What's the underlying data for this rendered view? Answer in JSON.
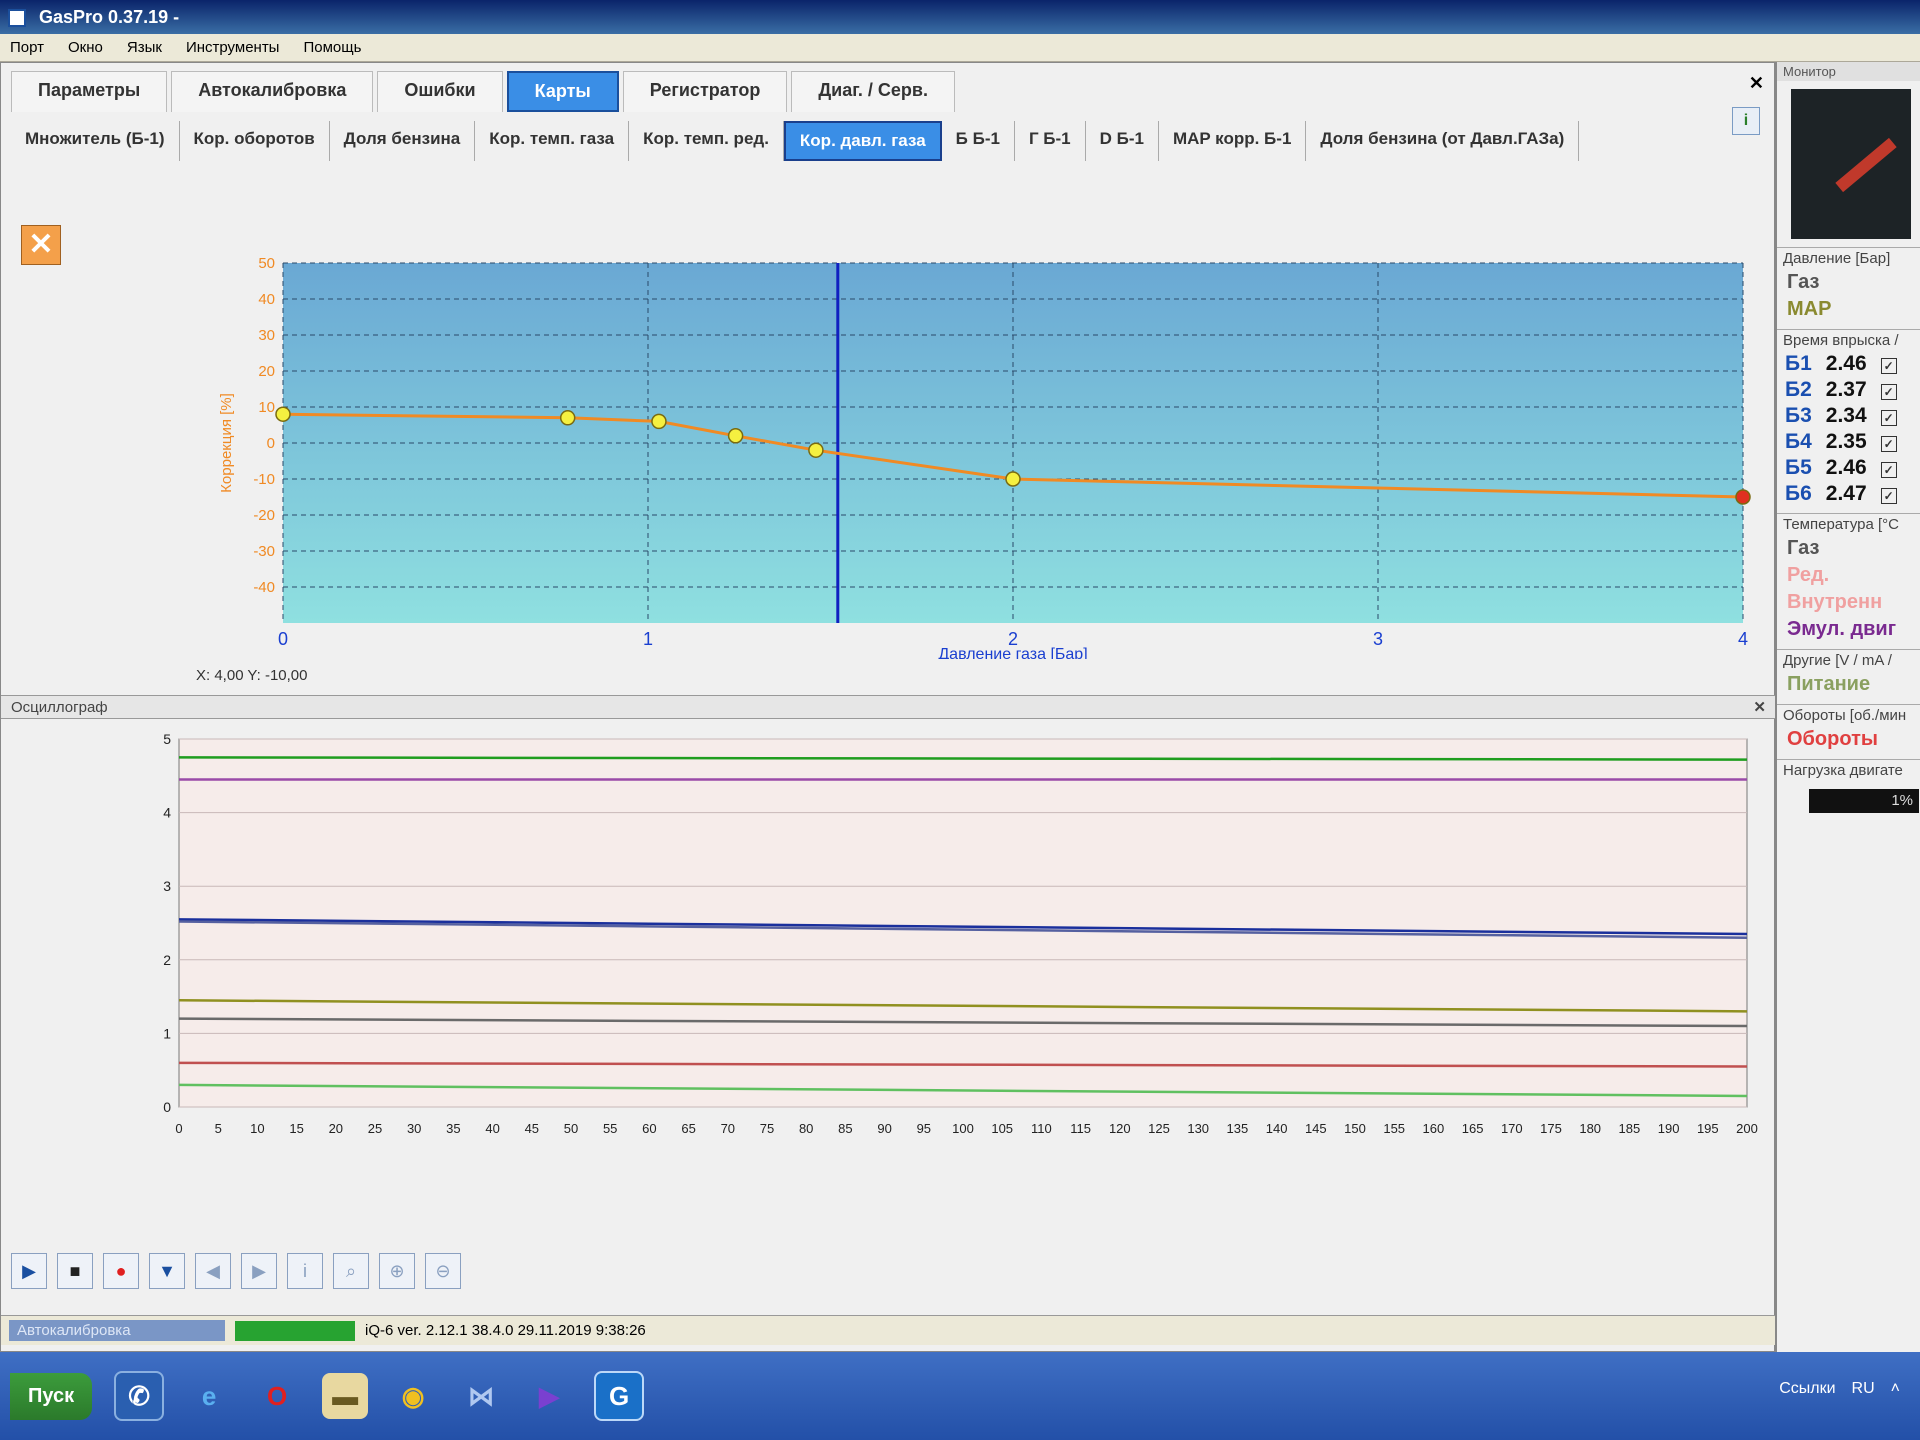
{
  "window": {
    "title": "GasPro 0.37.19 -"
  },
  "menu": [
    "Порт",
    "Окно",
    "Язык",
    "Инструменты",
    "Помощь"
  ],
  "main_tabs": [
    {
      "label": "Параметры"
    },
    {
      "label": "Автокалибровка"
    },
    {
      "label": "Ошибки"
    },
    {
      "label": "Карты",
      "active": true
    },
    {
      "label": "Регистратор"
    },
    {
      "label": "Диаг. / Серв."
    }
  ],
  "map_tabs": [
    {
      "label": "Множитель (Б-1)"
    },
    {
      "label": "Кор. оборотов"
    },
    {
      "label": "Доля бензина"
    },
    {
      "label": "Кор. темп. газа"
    },
    {
      "label": "Кор. темп. ред."
    },
    {
      "label": "Кор. давл. газа",
      "active": true
    },
    {
      "label": "Б Б-1"
    },
    {
      "label": "Г Б-1"
    },
    {
      "label": "D Б-1"
    },
    {
      "label": "MAP корр. Б-1"
    },
    {
      "label": "Доля бензина (от Давл.ГАЗа)"
    }
  ],
  "chart_data": {
    "type": "line",
    "xlabel": "Давление газа [Бар]",
    "ylabel": "Коррекция [%]",
    "xlim": [
      0,
      4
    ],
    "ylim": [
      -50,
      50
    ],
    "x_ticks": [
      0,
      1,
      2,
      3,
      4
    ],
    "y_ticks": [
      50,
      40,
      30,
      20,
      10,
      0,
      -10,
      -20,
      -30,
      -40
    ],
    "series": [
      {
        "x": [
          0,
          0.78,
          1.03,
          1.24,
          1.46,
          2.0,
          4.0
        ],
        "y": [
          8,
          7,
          6,
          2,
          -2,
          -10,
          -15
        ]
      }
    ],
    "cursor_x": 1.52,
    "line_color": "#f08a24",
    "point_color": "#f5f040",
    "selected_point_color": "#e03020"
  },
  "coord_readout": "X: 4,00  Y: -10,00",
  "oscilloscope": {
    "title": "Осциллограф",
    "y_ticks": [
      0,
      1,
      2,
      3,
      4,
      5
    ],
    "x_ticks": [
      0,
      5,
      10,
      15,
      20,
      25,
      30,
      35,
      40,
      45,
      50,
      55,
      60,
      65,
      70,
      75,
      80,
      85,
      90,
      95,
      100,
      105,
      110,
      115,
      120,
      125,
      130,
      135,
      140,
      145,
      150,
      155,
      160,
      165,
      170,
      175,
      180,
      185,
      190,
      195,
      200
    ],
    "traces": [
      {
        "color": "#1f9d1f",
        "y": [
          4.75,
          4.72
        ]
      },
      {
        "color": "#9a4aa8",
        "y": [
          4.45,
          4.45
        ]
      },
      {
        "color": "#1a2f9c",
        "y": [
          2.55,
          2.35
        ]
      },
      {
        "color": "#5560a0",
        "y": [
          2.52,
          2.3
        ]
      },
      {
        "color": "#909020",
        "y": [
          1.45,
          1.3
        ]
      },
      {
        "color": "#6a6a6a",
        "y": [
          1.2,
          1.1
        ]
      },
      {
        "color": "#c05050",
        "y": [
          0.6,
          0.55
        ]
      },
      {
        "color": "#60c060",
        "y": [
          0.3,
          0.15
        ]
      }
    ]
  },
  "status": {
    "text": "iQ-6  ver. 2.12.1  38.4.0  29.11.2019 9:38:26",
    "minitask": "Автокалибровка"
  },
  "monitor": {
    "title": "Монитор",
    "pressure_label": "Давление [Бар]",
    "pressure_items": [
      "Газ",
      "MAP"
    ],
    "injection_label": "Время впрыска /",
    "injectors": [
      {
        "name": "Б1",
        "value": "2.46"
      },
      {
        "name": "Б2",
        "value": "2.37"
      },
      {
        "name": "Б3",
        "value": "2.34"
      },
      {
        "name": "Б4",
        "value": "2.35"
      },
      {
        "name": "Б5",
        "value": "2.46"
      },
      {
        "name": "Б6",
        "value": "2.47"
      }
    ],
    "temp_label": "Температура [°C",
    "temp_items": [
      "Газ",
      "Ред.",
      "Внутренн"
    ],
    "emul_label": "Эмул. двиг",
    "other_label": "Другие [V / mA /",
    "power_label": "Питание",
    "rpm_label": "Обороты [об./мин",
    "rpm_value": "Обороты",
    "load_label": "Нагрузка двигате",
    "load_value": "1%"
  },
  "taskbar": {
    "start": "Пуск",
    "tray": [
      "Ссылки",
      "RU"
    ]
  }
}
